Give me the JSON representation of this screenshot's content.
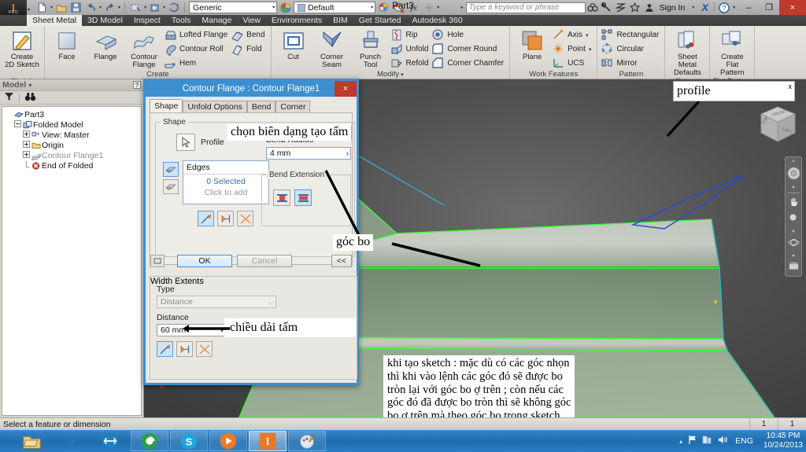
{
  "app": {
    "title": "Part3",
    "logo_mark": "I",
    "logo_sub": "PRO"
  },
  "titlebar": {
    "quick_access": [
      {
        "name": "new-file",
        "glyph": "□"
      },
      {
        "name": "open-file",
        "glyph": "⏏"
      },
      {
        "name": "save-file",
        "glyph": "▣"
      },
      {
        "name": "undo",
        "glyph": "↶"
      },
      {
        "name": "redo",
        "glyph": "↷"
      },
      {
        "name": "select-filter",
        "glyph": "⬚"
      },
      {
        "name": "return",
        "glyph": "↩"
      },
      {
        "name": "update",
        "glyph": "↻"
      }
    ],
    "material_combo": "Generic",
    "appearance_combo": "Default",
    "appearance_icons": [
      {
        "name": "clear-appearance-override",
        "glyph": "◑"
      },
      {
        "name": "adjust-appearance",
        "glyph": "◕"
      },
      {
        "name": "parameters",
        "glyph": "fx"
      },
      {
        "name": "add-to-quick-access",
        "glyph": "✚"
      }
    ],
    "search_placeholder": "Type a keyword or phrase",
    "help_icons": [
      {
        "name": "search-help-icon",
        "glyph": "⛿"
      },
      {
        "name": "wrench-icon",
        "glyph": "🔧"
      },
      {
        "name": "exchange-icon",
        "glyph": "⋑"
      },
      {
        "name": "favorites-star-icon",
        "glyph": "☆"
      },
      {
        "name": "account-person-icon",
        "glyph": "⚹"
      }
    ],
    "sign_in": "Sign In",
    "autodesk_x": "X",
    "help_mark": "?",
    "minimize": "–",
    "restore": "❐",
    "close": "×"
  },
  "ribbon_tabs": [
    {
      "label": "Sheet Metal",
      "active": true
    },
    {
      "label": "3D Model",
      "active": false
    },
    {
      "label": "Inspect",
      "active": false
    },
    {
      "label": "Tools",
      "active": false
    },
    {
      "label": "Manage",
      "active": false
    },
    {
      "label": "View",
      "active": false
    },
    {
      "label": "Environments",
      "active": false
    },
    {
      "label": "BIM",
      "active": false
    },
    {
      "label": "Get Started",
      "active": false
    },
    {
      "label": "Autodesk 360",
      "active": false
    }
  ],
  "ribbon_panels": [
    {
      "name": "sketch",
      "label": "Sketch",
      "big": [
        {
          "name": "create-2d-sketch",
          "label": "Create\n2D Sketch",
          "icon": "sketch-icon"
        }
      ],
      "small": []
    },
    {
      "name": "create",
      "label": "Create",
      "big": [
        {
          "name": "face",
          "label": "Face",
          "icon": "face-icon"
        },
        {
          "name": "flange",
          "label": "Flange",
          "icon": "flange-icon"
        },
        {
          "name": "contour-flange",
          "label": "Contour\nFlange",
          "icon": "contour-flange-icon"
        }
      ],
      "small": [
        [
          {
            "label": "Lofted Flange",
            "icon": "lofted-flange-icon"
          },
          {
            "label": "Contour Roll",
            "icon": "contour-roll-icon"
          },
          {
            "label": "Hem",
            "icon": "hem-icon"
          }
        ],
        [
          {
            "label": "Bend",
            "icon": "bend-icon"
          },
          {
            "label": "Fold",
            "icon": "fold-icon"
          }
        ]
      ]
    },
    {
      "name": "modify",
      "label": "Modify",
      "big": [
        {
          "name": "cut",
          "label": "Cut",
          "icon": "cut-icon"
        },
        {
          "name": "corner-seam",
          "label": "Corner\nSeam",
          "icon": "corner-seam-icon"
        },
        {
          "name": "punch-tool",
          "label": "Punch\nTool",
          "icon": "punch-tool-icon"
        }
      ],
      "small": [
        [
          {
            "label": "Rip",
            "icon": "rip-icon"
          },
          {
            "label": "Unfold",
            "icon": "unfold-icon"
          },
          {
            "label": "Refold",
            "icon": "refold-icon"
          }
        ],
        [
          {
            "label": "Hole",
            "icon": "hole-icon"
          },
          {
            "label": "Corner Round",
            "icon": "corner-round-icon"
          },
          {
            "label": "Corner Chamfer",
            "icon": "corner-chamfer-icon"
          }
        ]
      ]
    },
    {
      "name": "work-features",
      "label": "Work Features",
      "big": [
        {
          "name": "plane",
          "label": "Plane",
          "icon": "plane-icon"
        }
      ],
      "small": [
        [
          {
            "label": "Axis",
            "icon": "axis-icon",
            "caret": true
          },
          {
            "label": "Point",
            "icon": "point-icon",
            "caret": true
          },
          {
            "label": "UCS",
            "icon": "ucs-icon"
          }
        ]
      ]
    },
    {
      "name": "pattern",
      "label": "Pattern",
      "big": [],
      "small": [
        [
          {
            "label": "Rectangular",
            "icon": "rectangular-pattern-icon"
          },
          {
            "label": "Circular",
            "icon": "circular-pattern-icon"
          },
          {
            "label": "Mirror",
            "icon": "mirror-icon"
          }
        ]
      ]
    },
    {
      "name": "setup",
      "label": "Setup",
      "big": [
        {
          "name": "sheet-metal-defaults",
          "label": "Sheet Metal\nDefaults",
          "icon": "sheet-metal-defaults-icon"
        }
      ],
      "small": []
    },
    {
      "name": "flat-pattern",
      "label": "Flat Pattern",
      "big": [
        {
          "name": "create-flat-pattern",
          "label": "Create\nFlat Pattern",
          "icon": "flat-pattern-icon"
        }
      ],
      "small": []
    }
  ],
  "browser": {
    "header": "Model",
    "header_caret": "▾",
    "help_badge": "?",
    "tools": [
      {
        "name": "filter-icon",
        "glyph": "▽"
      },
      {
        "name": "find-binoculars-icon",
        "glyph": "⛿"
      }
    ],
    "tree": [
      {
        "label": "Part3",
        "depth": 0,
        "expander": "",
        "icon": "part-icon",
        "gray": false
      },
      {
        "label": "Folded Model",
        "depth": 1,
        "expander": "−",
        "icon": "folded-model-icon",
        "gray": false
      },
      {
        "label": "View: Master",
        "depth": 2,
        "expander": "+",
        "icon": "view-icon",
        "gray": false
      },
      {
        "label": "Origin",
        "depth": 2,
        "expander": "+",
        "icon": "folder-icon",
        "gray": false
      },
      {
        "label": "Contour Flange1",
        "depth": 2,
        "expander": "+",
        "icon": "contour-flange-icon",
        "gray": true
      },
      {
        "label": "End of Folded",
        "depth": 2,
        "expander": "",
        "icon": "end-of-part-icon",
        "gray": false
      }
    ]
  },
  "dialog": {
    "title": "Contour Flange : Contour Flange1",
    "close": "×",
    "tabs": [
      {
        "label": "Shape",
        "active": true
      },
      {
        "label": "Unfold Options",
        "active": false
      },
      {
        "label": "Bend",
        "active": false
      },
      {
        "label": "Corner",
        "active": false
      }
    ],
    "shape_group_label": "Shape",
    "profile_label": "Profile",
    "edges_header": "Edges",
    "edges_value": "0 Selected",
    "edges_hint": "Click to add",
    "bend_radius_label": "Bend Radius",
    "bend_radius_value": "4 mm",
    "bend_radius_arrow": "›",
    "bend_extension_label": "Bend Extension",
    "buttons": {
      "ok": "OK",
      "cancel": "Cancel",
      "expand": "<<",
      "more": "□"
    },
    "width_extents": {
      "group_label": "Width Extents",
      "type_label": "Type",
      "type_value": "Distance",
      "type_caret": "⌵",
      "distance_label": "Distance",
      "distance_value": "60 mm",
      "distance_caret": "▾"
    }
  },
  "annotations": [
    {
      "name": "annotation-profile",
      "text": "profile"
    },
    {
      "name": "annotation-chon-bien-dang",
      "text": "chọn biên dạng tạo tấm"
    },
    {
      "name": "annotation-goc-bo",
      "text": "góc bo"
    },
    {
      "name": "annotation-chieu-dai-tam",
      "text": "chiều dài tấm"
    },
    {
      "name": "annotation-sketch-note",
      "lines": [
        "khi tạo sketch : mặc dù có các góc nhọn",
        "thì khi vào lệnh các góc đó sẽ được bo",
        "tròn lại với góc bo ợ trên ; còn nếu các",
        "góc đó đã được bo tròn thì sẽ không góc",
        "bo ợ trên mà theo góc bo trong sketch"
      ]
    },
    {
      "name": "annotation-profile-close",
      "text": "x"
    }
  ],
  "navbar": {
    "items": [
      {
        "name": "full-navigation-wheel-icon",
        "glyph": "◎"
      },
      {
        "name": "pan-hand-icon",
        "glyph": "✋"
      },
      {
        "name": "zoom-magnifier-icon",
        "glyph": "⚲"
      },
      {
        "name": "orbit-icon",
        "glyph": "✤"
      },
      {
        "name": "look-at-icon",
        "glyph": "▤"
      }
    ],
    "close": "×"
  },
  "statusbar": {
    "message": "Select a feature or dimension",
    "cell1": "1",
    "cell2": "1"
  },
  "taskbar": {
    "apps": [
      {
        "name": "taskbar-file-explorer",
        "glyph": "🗂",
        "active": false,
        "flat": true
      },
      {
        "name": "taskbar-internet-explorer",
        "glyph": "e",
        "active": false,
        "flat": true
      },
      {
        "name": "taskbar-teamviewer",
        "glyph": "⇄",
        "active": false,
        "flat": true
      },
      {
        "name": "taskbar-browser-green",
        "glyph": "◎",
        "active": false,
        "flat": false
      },
      {
        "name": "taskbar-skype",
        "glyph": "S",
        "active": false,
        "flat": false
      },
      {
        "name": "taskbar-media-player",
        "glyph": "▶",
        "active": false,
        "flat": false
      },
      {
        "name": "taskbar-inventor",
        "glyph": "I",
        "active": true,
        "flat": false
      },
      {
        "name": "taskbar-paint",
        "glyph": "🖌",
        "active": false,
        "flat": false
      }
    ],
    "tray": [
      {
        "name": "show-hidden-icons",
        "glyph": "▴"
      },
      {
        "name": "action-center-flag-icon",
        "glyph": "⚑"
      },
      {
        "name": "network-icon",
        "glyph": "▖"
      },
      {
        "name": "volume-icon",
        "glyph": "🔊"
      }
    ],
    "language": "ENG",
    "time": "10:45 PM",
    "date": "10/24/2013"
  },
  "colors": {
    "accent": "#3d8fd0",
    "close_red": "#c0392b",
    "model_green": "#3ef53e",
    "model_blue": "#2a49d8",
    "edge_cyan": "#3aa8c8",
    "link": "#3a6ea5"
  }
}
